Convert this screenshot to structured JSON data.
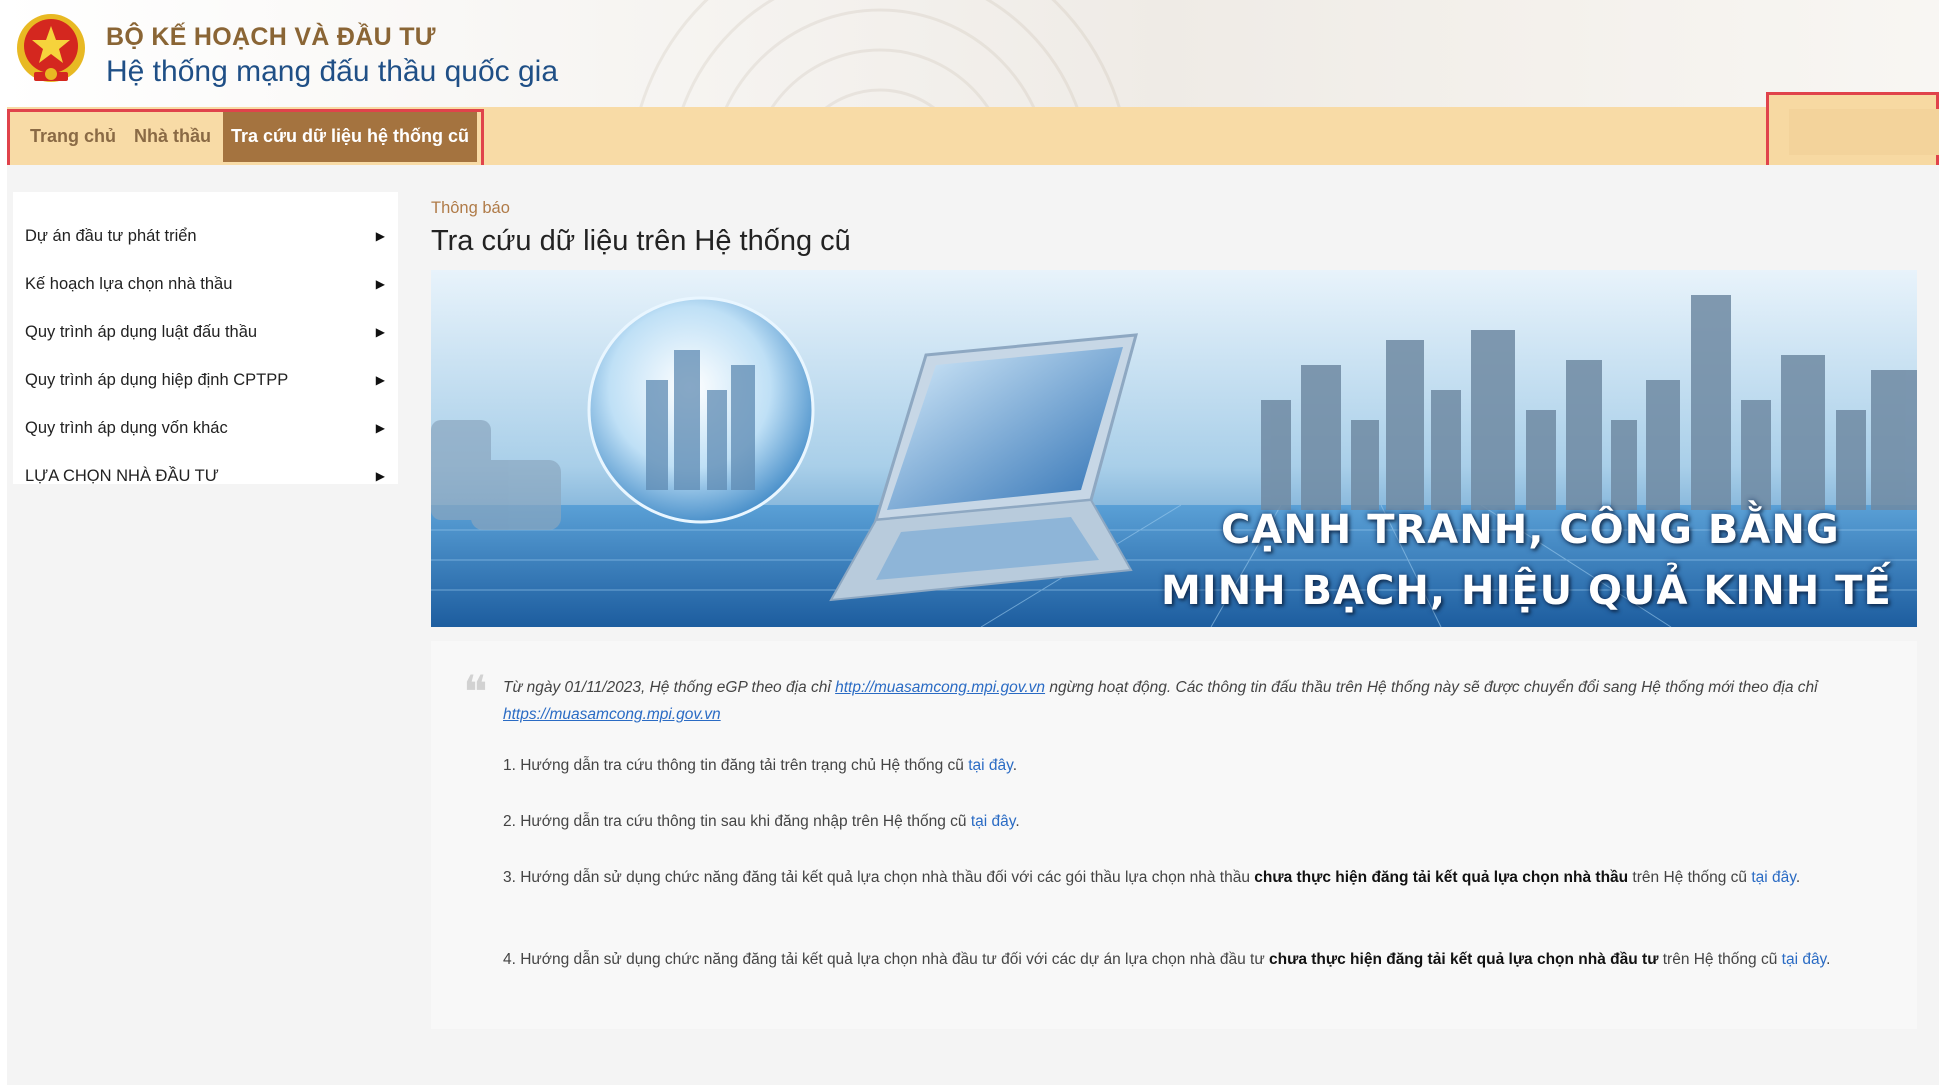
{
  "header": {
    "ministry_name": "BỘ KẾ HOẠCH VÀ ĐẦU TƯ",
    "system_name": "Hệ thống mạng đấu thầu quốc gia"
  },
  "nav": {
    "items": [
      {
        "label": "Trang chủ"
      },
      {
        "label": "Nhà thầu"
      },
      {
        "label": "Tra cứu dữ liệu hệ thống cũ",
        "active": true
      }
    ]
  },
  "sidebar": {
    "items": [
      {
        "label": "Dự án đầu tư phát triển"
      },
      {
        "label": "Kế hoạch lựa chọn nhà thầu"
      },
      {
        "label": "Quy trình áp dụng luật đấu thầu"
      },
      {
        "label": "Quy trình áp dụng hiệp định CPTPP"
      },
      {
        "label": "Quy trình áp dụng vốn khác"
      },
      {
        "label": "LỰA CHỌN NHÀ ĐẦU TƯ"
      }
    ],
    "arrow": "▶"
  },
  "main": {
    "breadcrumb": "Thông báo",
    "title": "Tra cứu dữ liệu trên Hệ thống cũ",
    "banner": {
      "line1": "CẠNH TRANH, CÔNG BẰNG",
      "line2": "MINH BẠCH, HIỆU QUẢ KINH TẾ"
    }
  },
  "notice": {
    "quote_mark": "❝",
    "intro_before": "Từ ngày 01/11/2023, Hệ thống eGP theo địa chỉ ",
    "intro_link1": "http://muasamcong.mpi.gov.vn",
    "intro_middle": " ngừng hoạt động. Các thông tin đấu thầu trên Hệ thống này sẽ được chuyển đổi sang Hệ thống mới theo địa chỉ ",
    "intro_link2": "https://muasamcong.mpi.gov.vn",
    "item1_text": "1. Hướng dẫn tra cứu thông tin đăng tải trên trạng chủ Hệ thống cũ ",
    "item2_text": "2. Hướng dẫn tra cứu thông tin sau khi đăng nhập trên Hệ thống cũ ",
    "item3_text": "3. Hướng dẫn sử dụng chức năng đăng tải kết quả lựa chọn nhà thầu đối với các gói thầu lựa chọn nhà thầu ",
    "item3_bold": "chưa thực hiện đăng tải kết quả lựa chọn nhà thầu",
    "item3_after": " trên Hệ thống cũ ",
    "item4_text": "4. Hướng dẫn sử dụng chức năng đăng tải kết quả lựa chọn nhà đầu tư đối với các dự án lựa chọn nhà đầu tư ",
    "item4_bold": "chưa thực hiện đăng tải kết quả lựa chọn nhà đầu tư",
    "item4_after": " trên Hệ thống cũ ",
    "link_here": "tại đây",
    "period": "."
  },
  "colors": {
    "nav_bg": "#f8dba6",
    "nav_active_bg": "#a4733f",
    "ministry_text": "#8a6535",
    "system_text": "#1f4f86",
    "highlight_border": "#e0434b",
    "link": "#2a6bc4"
  }
}
